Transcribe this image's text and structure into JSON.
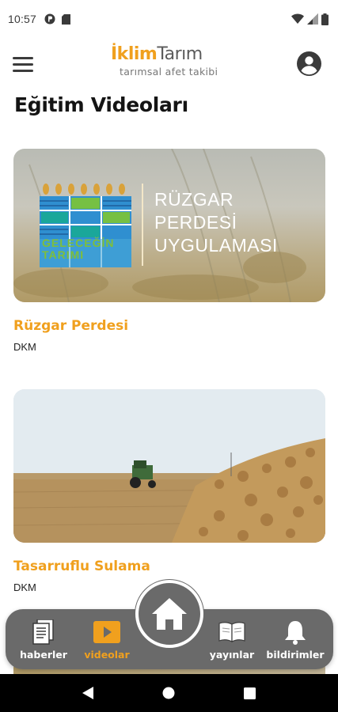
{
  "status_bar": {
    "time": "10:57"
  },
  "header": {
    "logo_brand_highlight": "İklim",
    "logo_brand_rest": "Tarım",
    "logo_tagline": "tarımsal afet takibi"
  },
  "page": {
    "title": "Eğitim Videoları"
  },
  "videos": [
    {
      "title": "Rüzgar Perdesi",
      "source": "DKM",
      "thumbnail": {
        "brand_line1": "GELECEĞİN",
        "brand_line2": "TARIMI",
        "text_line1": "RÜZGAR",
        "text_line2": "PERDESİ",
        "text_line3": "UYGULAMASI"
      }
    },
    {
      "title": "Tasarruflu Sulama",
      "source": "DKM"
    }
  ],
  "bottom_nav": {
    "items": [
      {
        "label": "haberler",
        "icon": "document-icon",
        "active": false
      },
      {
        "label": "videolar",
        "icon": "play-icon",
        "active": true
      },
      {
        "label": "yayınlar",
        "icon": "book-icon",
        "active": false
      },
      {
        "label": "bildirimler",
        "icon": "bell-icon",
        "active": false
      }
    ],
    "home_icon": "home-icon"
  },
  "colors": {
    "accent": "#f0a01e",
    "nav_background": "#6a6a6a",
    "text": "#141414"
  }
}
